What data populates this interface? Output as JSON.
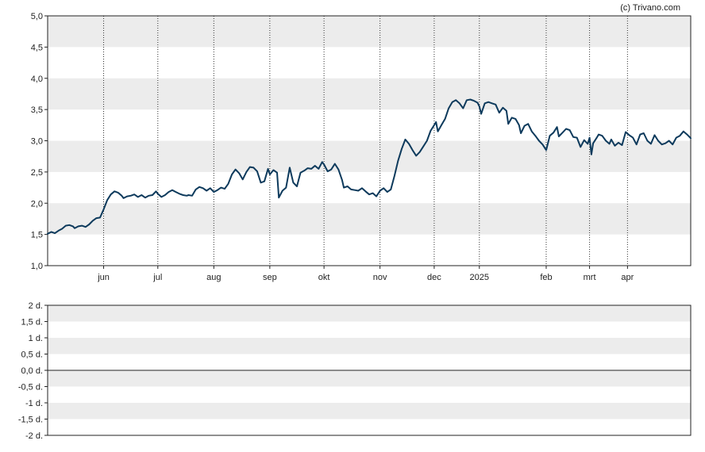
{
  "credit": "(c) Trivano.com",
  "colors": {
    "line": "#0d3a5c",
    "band": "#ececec",
    "axis": "#222222",
    "grid": "#333333"
  },
  "chart_data": [
    {
      "type": "line",
      "y_tick_labels": [
        "1,0",
        "1,5",
        "2,0",
        "2,5",
        "3,0",
        "3,5",
        "4,0",
        "4,5",
        "5,0"
      ],
      "ylim": [
        1.0,
        5.0
      ],
      "x_tick_labels": [
        "jun",
        "jul",
        "aug",
        "sep",
        "okt",
        "nov",
        "dec",
        "2025",
        "feb",
        "mrt",
        "apr"
      ],
      "x_ticks_day": [
        31,
        61,
        92,
        123,
        153,
        184,
        214,
        239,
        276,
        300,
        321
      ],
      "x_range_day": [
        0,
        356
      ],
      "grid": "dotted vertical at month ticks, alternating horizontal bands",
      "series": [
        {
          "points": [
            [
              0,
              1.51
            ],
            [
              2,
              1.54
            ],
            [
              4,
              1.52
            ],
            [
              6,
              1.56
            ],
            [
              8,
              1.59
            ],
            [
              10,
              1.64
            ],
            [
              12,
              1.65
            ],
            [
              14,
              1.63
            ],
            [
              15,
              1.6
            ],
            [
              17,
              1.63
            ],
            [
              19,
              1.64
            ],
            [
              21,
              1.62
            ],
            [
              23,
              1.66
            ],
            [
              25,
              1.72
            ],
            [
              27,
              1.76
            ],
            [
              29,
              1.77
            ],
            [
              31,
              1.9
            ],
            [
              33,
              2.05
            ],
            [
              35,
              2.14
            ],
            [
              37,
              2.19
            ],
            [
              39,
              2.17
            ],
            [
              41,
              2.12
            ],
            [
              42,
              2.08
            ],
            [
              44,
              2.11
            ],
            [
              46,
              2.12
            ],
            [
              48,
              2.14
            ],
            [
              50,
              2.1
            ],
            [
              52,
              2.13
            ],
            [
              54,
              2.09
            ],
            [
              56,
              2.12
            ],
            [
              58,
              2.13
            ],
            [
              60,
              2.19
            ],
            [
              61,
              2.15
            ],
            [
              63,
              2.1
            ],
            [
              65,
              2.13
            ],
            [
              67,
              2.18
            ],
            [
              69,
              2.21
            ],
            [
              71,
              2.18
            ],
            [
              73,
              2.15
            ],
            [
              75,
              2.13
            ],
            [
              77,
              2.12
            ],
            [
              78,
              2.13
            ],
            [
              80,
              2.12
            ],
            [
              82,
              2.22
            ],
            [
              84,
              2.26
            ],
            [
              86,
              2.24
            ],
            [
              88,
              2.2
            ],
            [
              90,
              2.24
            ],
            [
              92,
              2.18
            ],
            [
              94,
              2.21
            ],
            [
              96,
              2.25
            ],
            [
              98,
              2.23
            ],
            [
              100,
              2.31
            ],
            [
              102,
              2.46
            ],
            [
              104,
              2.54
            ],
            [
              106,
              2.48
            ],
            [
              108,
              2.38
            ],
            [
              110,
              2.5
            ],
            [
              112,
              2.58
            ],
            [
              114,
              2.57
            ],
            [
              116,
              2.51
            ],
            [
              118,
              2.33
            ],
            [
              120,
              2.35
            ],
            [
              122,
              2.55
            ],
            [
              123,
              2.46
            ],
            [
              125,
              2.53
            ],
            [
              127,
              2.49
            ],
            [
              128,
              2.09
            ],
            [
              130,
              2.2
            ],
            [
              132,
              2.25
            ],
            [
              134,
              2.57
            ],
            [
              136,
              2.33
            ],
            [
              138,
              2.27
            ],
            [
              140,
              2.49
            ],
            [
              142,
              2.52
            ],
            [
              144,
              2.56
            ],
            [
              146,
              2.55
            ],
            [
              148,
              2.6
            ],
            [
              150,
              2.55
            ],
            [
              152,
              2.66
            ],
            [
              153,
              2.62
            ],
            [
              155,
              2.51
            ],
            [
              157,
              2.54
            ],
            [
              159,
              2.63
            ],
            [
              161,
              2.54
            ],
            [
              163,
              2.37
            ],
            [
              164,
              2.25
            ],
            [
              166,
              2.27
            ],
            [
              168,
              2.22
            ],
            [
              170,
              2.21
            ],
            [
              172,
              2.2
            ],
            [
              174,
              2.24
            ],
            [
              176,
              2.19
            ],
            [
              178,
              2.14
            ],
            [
              180,
              2.16
            ],
            [
              182,
              2.11
            ],
            [
              184,
              2.2
            ],
            [
              186,
              2.24
            ],
            [
              188,
              2.18
            ],
            [
              190,
              2.22
            ],
            [
              192,
              2.44
            ],
            [
              194,
              2.68
            ],
            [
              196,
              2.87
            ],
            [
              198,
              3.02
            ],
            [
              200,
              2.95
            ],
            [
              202,
              2.85
            ],
            [
              204,
              2.76
            ],
            [
              206,
              2.82
            ],
            [
              208,
              2.91
            ],
            [
              210,
              3.0
            ],
            [
              212,
              3.16
            ],
            [
              214,
              3.25
            ],
            [
              215,
              3.3
            ],
            [
              216,
              3.15
            ],
            [
              218,
              3.25
            ],
            [
              220,
              3.35
            ],
            [
              222,
              3.52
            ],
            [
              224,
              3.62
            ],
            [
              226,
              3.65
            ],
            [
              228,
              3.6
            ],
            [
              230,
              3.52
            ],
            [
              232,
              3.65
            ],
            [
              234,
              3.66
            ],
            [
              236,
              3.64
            ],
            [
              238,
              3.61
            ],
            [
              239,
              3.55
            ],
            [
              240,
              3.43
            ],
            [
              242,
              3.6
            ],
            [
              244,
              3.62
            ],
            [
              246,
              3.6
            ],
            [
              248,
              3.58
            ],
            [
              250,
              3.45
            ],
            [
              252,
              3.53
            ],
            [
              254,
              3.48
            ],
            [
              255,
              3.27
            ],
            [
              257,
              3.37
            ],
            [
              259,
              3.35
            ],
            [
              261,
              3.25
            ],
            [
              262,
              3.12
            ],
            [
              264,
              3.24
            ],
            [
              266,
              3.27
            ],
            [
              268,
              3.15
            ],
            [
              270,
              3.08
            ],
            [
              272,
              3.0
            ],
            [
              274,
              2.94
            ],
            [
              276,
              2.85
            ],
            [
              278,
              3.08
            ],
            [
              280,
              3.13
            ],
            [
              282,
              3.22
            ],
            [
              283,
              3.07
            ],
            [
              285,
              3.13
            ],
            [
              287,
              3.19
            ],
            [
              289,
              3.17
            ],
            [
              291,
              3.06
            ],
            [
              293,
              3.05
            ],
            [
              295,
              2.9
            ],
            [
              297,
              3.01
            ],
            [
              299,
              2.95
            ],
            [
              300,
              3.05
            ],
            [
              301,
              2.78
            ],
            [
              302,
              2.96
            ],
            [
              304,
              3.05
            ],
            [
              305,
              3.1
            ],
            [
              307,
              3.08
            ],
            [
              309,
              3.0
            ],
            [
              311,
              2.95
            ],
            [
              312,
              3.02
            ],
            [
              314,
              2.92
            ],
            [
              316,
              2.97
            ],
            [
              318,
              2.93
            ],
            [
              320,
              3.14
            ],
            [
              322,
              3.09
            ],
            [
              324,
              3.05
            ],
            [
              326,
              2.94
            ],
            [
              328,
              3.1
            ],
            [
              330,
              3.12
            ],
            [
              332,
              3.0
            ],
            [
              334,
              2.95
            ],
            [
              336,
              3.09
            ],
            [
              338,
              3.0
            ],
            [
              340,
              2.94
            ],
            [
              342,
              2.96
            ],
            [
              344,
              3.0
            ],
            [
              346,
              2.94
            ],
            [
              348,
              3.05
            ],
            [
              350,
              3.08
            ],
            [
              352,
              3.15
            ],
            [
              354,
              3.1
            ],
            [
              356,
              3.04
            ]
          ]
        }
      ]
    },
    {
      "type": "line",
      "y_tick_labels": [
        "-2 d.",
        "-1,5 d.",
        "-1 d.",
        "-0,5 d.",
        "0,0 d.",
        "0,5 d.",
        "1 d.",
        "1,5 d.",
        "2 d."
      ],
      "ylim": [
        -2,
        2
      ],
      "series": [
        {
          "points": []
        }
      ]
    }
  ]
}
